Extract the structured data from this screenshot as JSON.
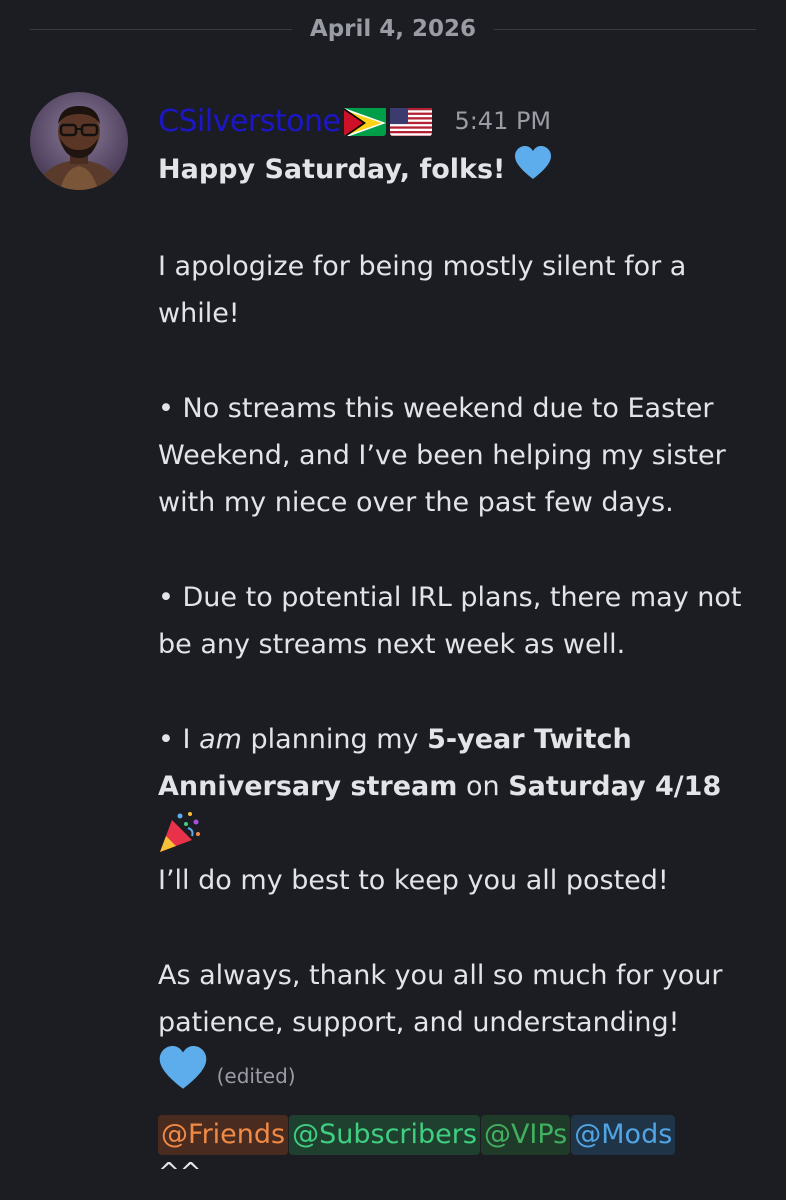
{
  "date_divider": "April 4, 2026",
  "message": {
    "username": "CSilverstone",
    "flags": [
      "guyana-flag",
      "usa-flag"
    ],
    "timestamp": "5:41 PM",
    "greeting": "Happy Saturday, folks!",
    "apology": "I apologize for being mostly silent for a while!",
    "bullet1": "• No streams this weekend due to Easter Weekend, and I’ve been helping my sister with my niece over the past few days.",
    "bullet2": "• Due to potential IRL plans, there may not be any streams next week as well.",
    "bullet3": {
      "prefix": "• I ",
      "italic": "am",
      "mid1": " planning my ",
      "bold1": "5-year Twitch Anniversary stream",
      "mid2": " on ",
      "bold2": "Saturday 4/18"
    },
    "posted": "I’ll do my best to keep you all posted!",
    "thanks": "As always, thank you all so much for your patience, support, and understanding!",
    "edited": "(edited)",
    "mentions": {
      "friends": "@Friends",
      "subscribers": "@Subscribers",
      "vips": "@VIPs",
      "mods": "@Mods"
    },
    "trailing": "^^"
  },
  "colors": {
    "background": "#1c1d22",
    "username": "#1b17c7",
    "text": "#e3e4e8",
    "muted": "#9a9ca5"
  },
  "icons": [
    "blue-heart-icon",
    "party-popper-icon",
    "avatar"
  ]
}
